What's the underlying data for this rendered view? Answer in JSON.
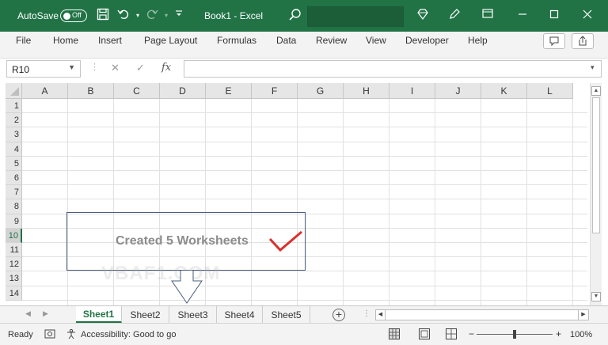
{
  "titlebar": {
    "autosave_label": "AutoSave",
    "autosave_state": "Off",
    "title": "Book1 - Excel"
  },
  "menu": {
    "items": [
      "File",
      "Home",
      "Insert",
      "Page Layout",
      "Formulas",
      "Data",
      "Review",
      "View",
      "Developer",
      "Help"
    ]
  },
  "formula_bar": {
    "name_box": "R10",
    "fx_label": "fx",
    "formula_value": ""
  },
  "grid": {
    "columns": [
      "A",
      "B",
      "C",
      "D",
      "E",
      "F",
      "G",
      "H",
      "I",
      "J",
      "K",
      "L"
    ],
    "rows": [
      "1",
      "2",
      "3",
      "4",
      "5",
      "6",
      "7",
      "8",
      "9",
      "10",
      "11",
      "12",
      "13",
      "14"
    ],
    "selected_row": "10"
  },
  "callout": {
    "text": "Created 5 Worksheets",
    "watermark": "VBAF1.COM"
  },
  "sheets": {
    "tabs": [
      "Sheet1",
      "Sheet2",
      "Sheet3",
      "Sheet4",
      "Sheet5"
    ],
    "active": "Sheet1",
    "add_label": "+"
  },
  "status": {
    "ready": "Ready",
    "accessibility": "Accessibility: Good to go",
    "zoom": "100%",
    "zoom_minus": "−",
    "zoom_plus": "+"
  },
  "colors": {
    "accent": "#217346",
    "callout_border": "#4a5c7a",
    "check": "#d9302c"
  }
}
